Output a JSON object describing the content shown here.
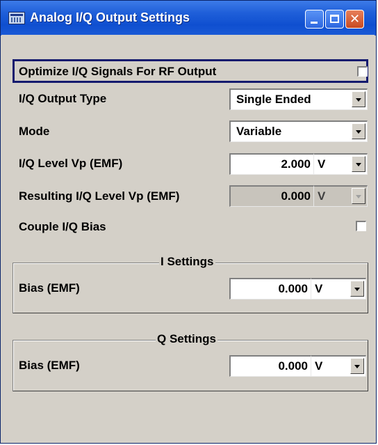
{
  "window": {
    "title": "Analog I/Q Output Settings"
  },
  "optimize": {
    "label": "Optimize I/Q Signals For RF Output",
    "checked": false
  },
  "output_type": {
    "label": "I/Q Output Type",
    "value": "Single Ended"
  },
  "mode": {
    "label": "Mode",
    "value": "Variable"
  },
  "iq_level": {
    "label": "I/Q Level Vp (EMF)",
    "value": "2.000",
    "unit": "V"
  },
  "resulting_level": {
    "label": "Resulting I/Q Level Vp (EMF)",
    "value": "0.000",
    "unit": "V"
  },
  "couple_bias": {
    "label": "Couple I/Q Bias",
    "checked": false
  },
  "i_settings": {
    "title": "I Settings",
    "bias_label": "Bias (EMF)",
    "bias_value": "0.000",
    "bias_unit": "V"
  },
  "q_settings": {
    "title": "Q Settings",
    "bias_label": "Bias (EMF)",
    "bias_value": "0.000",
    "bias_unit": "V"
  }
}
